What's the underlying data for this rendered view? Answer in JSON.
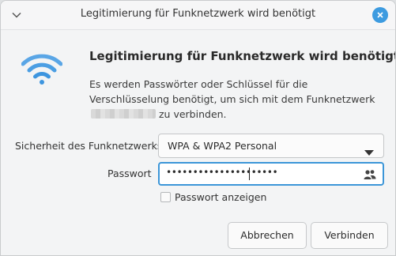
{
  "window": {
    "title": "Legitimierung für Funknetzwerk wird benötigt"
  },
  "dialog": {
    "heading": "Legitimierung für Funknetzwerk wird benötigt",
    "description_before": "Es werden Passwörter oder Schlüssel für die Verschlüsselung benötigt, um sich mit dem Funknetzwerk",
    "description_after": "zu verbinden."
  },
  "security": {
    "label": "Sicherheit des Funknetzwerks",
    "selected": "WPA & WPA2 Personal"
  },
  "password": {
    "label": "Passwort",
    "masked_value": "•••••••••••••••••••••"
  },
  "show_password": {
    "label": "Passwort anzeigen",
    "checked": false
  },
  "buttons": {
    "cancel": "Abbrechen",
    "connect": "Verbinden"
  },
  "colors": {
    "accent": "#3d9be0",
    "focus_border": "#3c96d8"
  },
  "icons": {
    "window_menu": "chevron-down-icon",
    "close": "close-icon",
    "dialog": "wifi-icon",
    "dropdown": "caret-down-icon",
    "password_storage": "users-icon"
  }
}
